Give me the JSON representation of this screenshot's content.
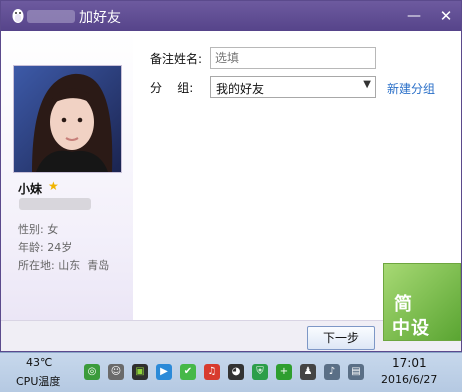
{
  "window": {
    "title": "加好友",
    "minimize_icon": "minimize-icon",
    "close_icon": "close-icon"
  },
  "profile": {
    "nickname": "小妹",
    "gender": "性别: 女",
    "age": "年龄: 24岁",
    "location": "所在地: 山东  青岛"
  },
  "form": {
    "remark_label": "备注姓名:",
    "remark_placeholder": "选填",
    "group_label": "分    组:",
    "group_value": "我的好友",
    "new_group_link": "新建分组"
  },
  "footer": {
    "next_button": "下一步"
  },
  "taskbar": {
    "cpu_temp": "43℃",
    "cpu_label": "CPU温度",
    "time": "17:01",
    "date": "2016/6/27"
  },
  "watermark": {
    "line1": "简",
    "line2": "中设"
  },
  "colors": {
    "titlebar": "#5e4c93",
    "link": "#2a6fc8",
    "star": "#f0b400"
  }
}
